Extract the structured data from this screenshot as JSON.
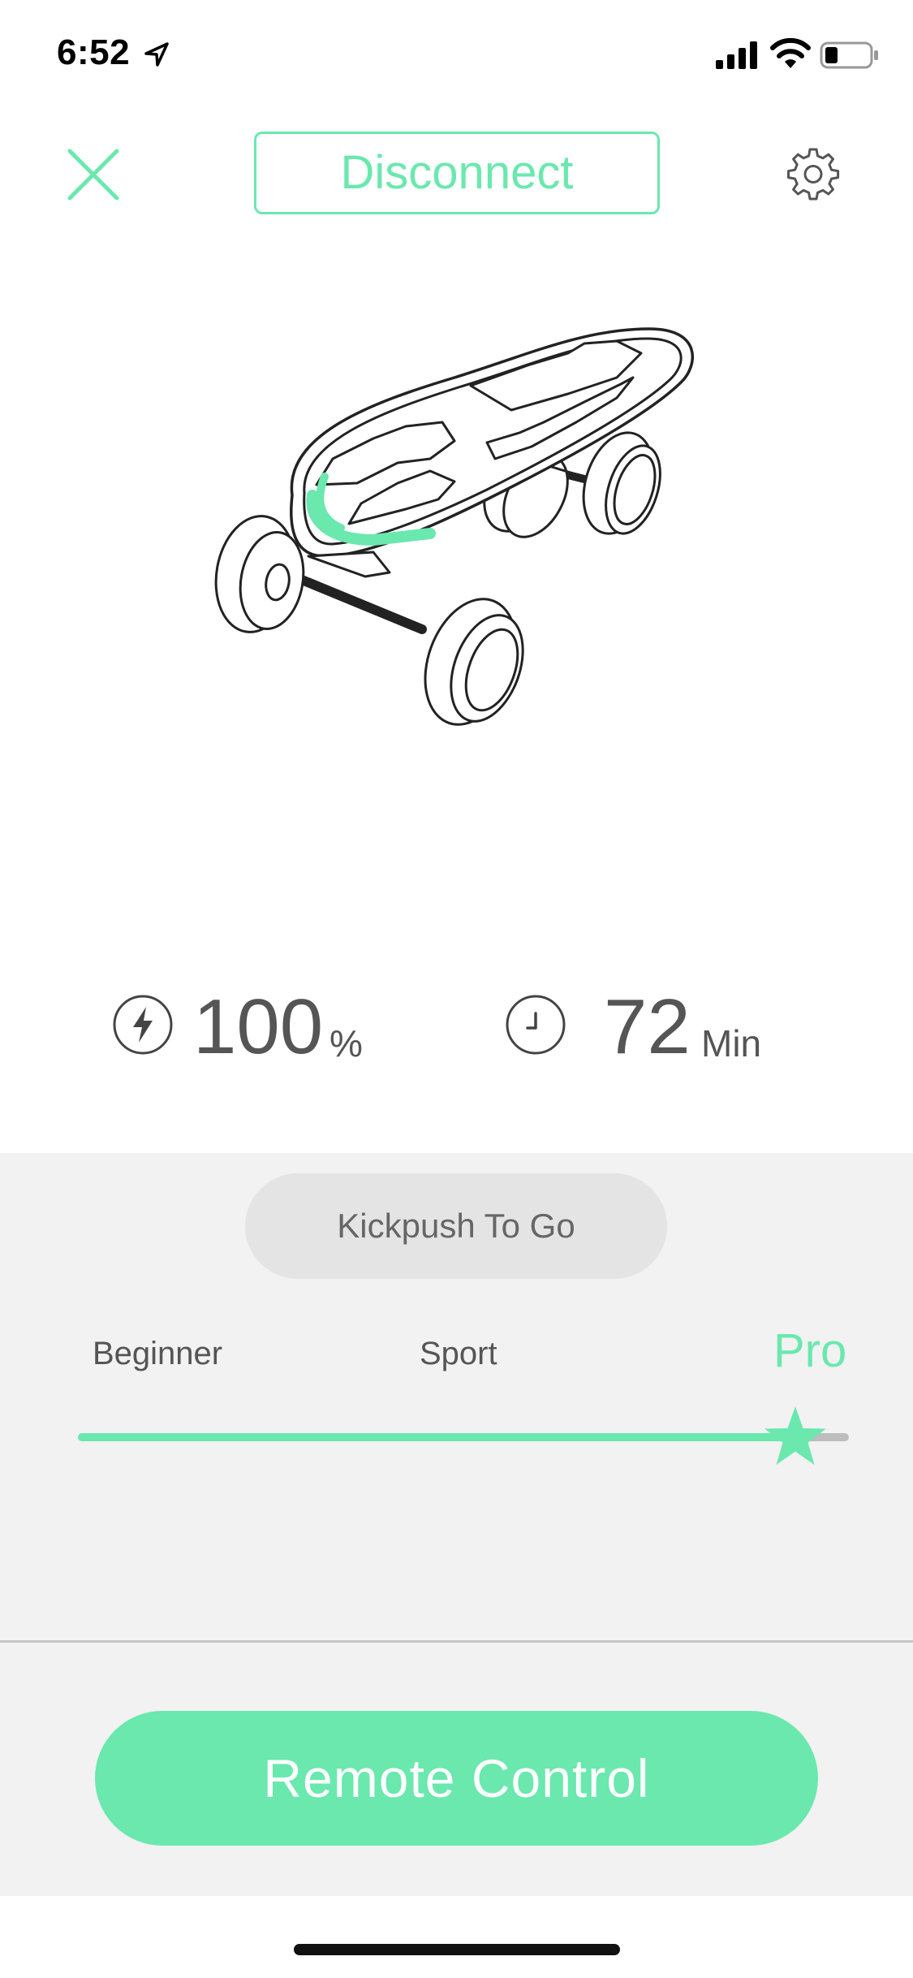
{
  "status_bar": {
    "time": "6:52",
    "icons": [
      "location-arrow-icon",
      "cellular-signal-icon",
      "wifi-icon",
      "battery-icon"
    ]
  },
  "header": {
    "close_icon": "close-icon",
    "disconnect_label": "Disconnect",
    "settings_icon": "gear-icon"
  },
  "stats": {
    "battery": {
      "icon": "lightning-bolt-icon",
      "value": "100",
      "unit": "%"
    },
    "ride_time": {
      "icon": "clock-icon",
      "value": "72",
      "unit": "Min"
    }
  },
  "controls": {
    "kickpush_label": "Kickpush To Go",
    "modes": [
      "Beginner",
      "Sport",
      "Pro"
    ],
    "selected_mode": "Pro",
    "slider_level_percent": 93,
    "remote_label": "Remote Control"
  },
  "colors": {
    "accent": "#6ae8ae",
    "panel_bg": "#f2f2f2",
    "text": "#555555"
  }
}
